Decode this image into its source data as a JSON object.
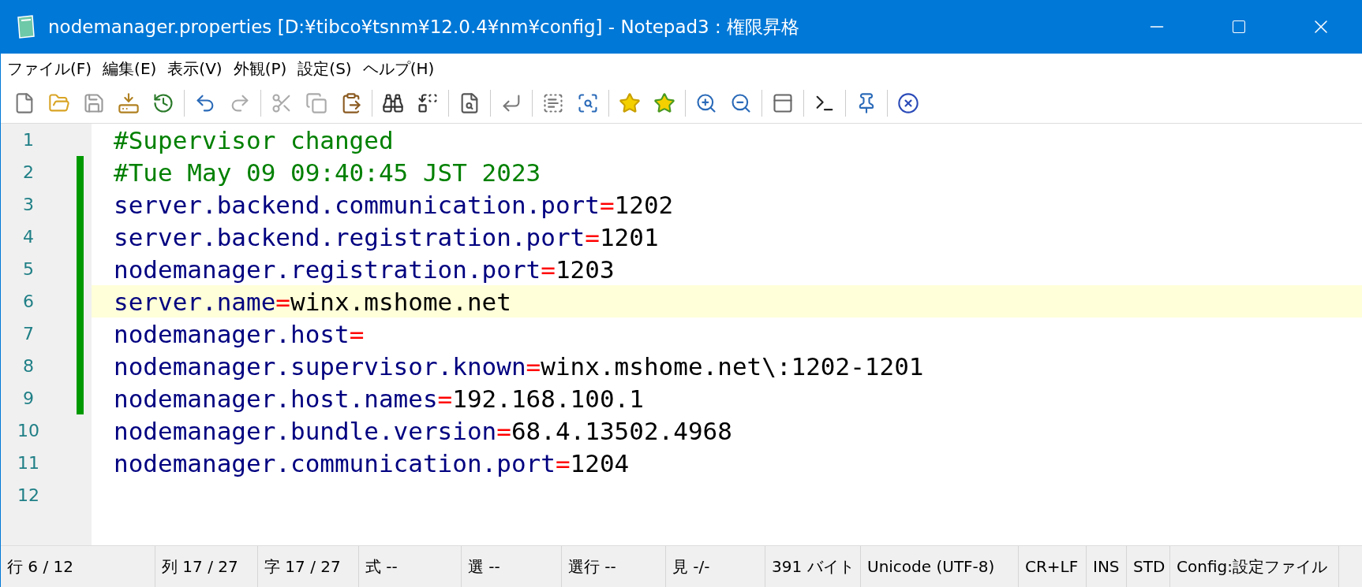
{
  "window": {
    "title": "nodemanager.properties [D:¥tibco¥tsnm¥12.0.4¥nm¥config] - Notepad3 : 権限昇格"
  },
  "menu": [
    "ファイル(F)",
    "編集(E)",
    "表示(V)",
    "外観(P)",
    "設定(S)",
    "ヘルプ(H)"
  ],
  "editor": {
    "lines": [
      {
        "number": "1",
        "kind": "comment",
        "text": "#Supervisor changed",
        "changed": false,
        "current": false
      },
      {
        "number": "2",
        "kind": "comment",
        "text": "#Tue May 09 09:40:45 JST 2023",
        "changed": true,
        "current": false
      },
      {
        "number": "3",
        "kind": "property",
        "key": "server.backend.communication.port",
        "sep": "=",
        "value": "1202",
        "changed": true,
        "current": false
      },
      {
        "number": "4",
        "kind": "property",
        "key": "server.backend.registration.port",
        "sep": "=",
        "value": "1201",
        "changed": true,
        "current": false
      },
      {
        "number": "5",
        "kind": "property",
        "key": "nodemanager.registration.port",
        "sep": "=",
        "value": "1203",
        "changed": true,
        "current": false
      },
      {
        "number": "6",
        "kind": "property",
        "key": "server.name",
        "sep": "=",
        "value": "winx.mshome.net",
        "changed": true,
        "current": true
      },
      {
        "number": "7",
        "kind": "property",
        "key": "nodemanager.host",
        "sep": "=",
        "changed": true,
        "current": false
      },
      {
        "number": "8",
        "kind": "property",
        "key": "nodemanager.supervisor.known",
        "sep": "=",
        "value": "winx.mshome.net\\:1202-1201",
        "changed": true,
        "current": false
      },
      {
        "number": "9",
        "kind": "property",
        "key": "nodemanager.host.names",
        "sep": "=",
        "value": "192.168.100.1",
        "changed": true,
        "current": false
      },
      {
        "number": "10",
        "kind": "property",
        "key": "nodemanager.bundle.version",
        "sep": "=",
        "value": "68.4.13502.4968",
        "changed": false,
        "current": false
      },
      {
        "number": "11",
        "kind": "property",
        "key": "nodemanager.communication.port",
        "sep": "=",
        "value": "1204",
        "changed": false,
        "current": false
      },
      {
        "number": "12",
        "kind": "blank",
        "changed": false,
        "current": false
      }
    ]
  },
  "status_bar": [
    "行 6 / 12",
    "列 17 / 27",
    "字 17 / 27",
    "式 --",
    "選 --",
    "選行 --",
    "見 -/-",
    "391 バイト",
    "Unicode (UTF-8)",
    "CR+LF",
    "INS",
    "STD",
    "Config:設定ファイル"
  ]
}
